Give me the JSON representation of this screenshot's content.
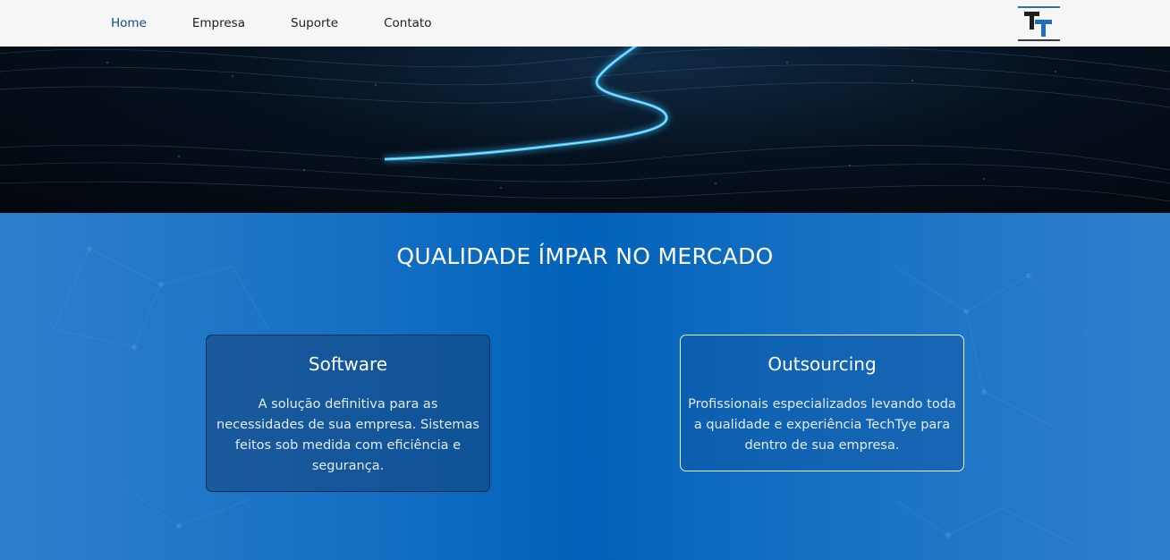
{
  "nav": {
    "items": [
      {
        "label": "Home",
        "active": true
      },
      {
        "label": "Empresa",
        "active": false
      },
      {
        "label": "Suporte",
        "active": false
      },
      {
        "label": "Contato",
        "active": false
      }
    ],
    "logo_letters": "TT"
  },
  "hero": {
    "background": "dark network wave with glowing blue line"
  },
  "section": {
    "headline": "QUALIDADE ÍMPAR NO MERCADO",
    "cards": [
      {
        "title": "Software",
        "text": "A solução definitiva para as necessidades de sua empresa. Sistemas feitos sob medida com eficiência e segurança."
      },
      {
        "title": "Outsourcing",
        "text": "Profissionais especializados levando toda a qualidade e experiência TechTye para dentro de sua empresa."
      }
    ]
  },
  "colors": {
    "nav_bg": "#f6f6f6",
    "nav_active": "#0d4d8c",
    "section_bg": "#0062b8",
    "hero_glow": "#3fc3ff"
  }
}
